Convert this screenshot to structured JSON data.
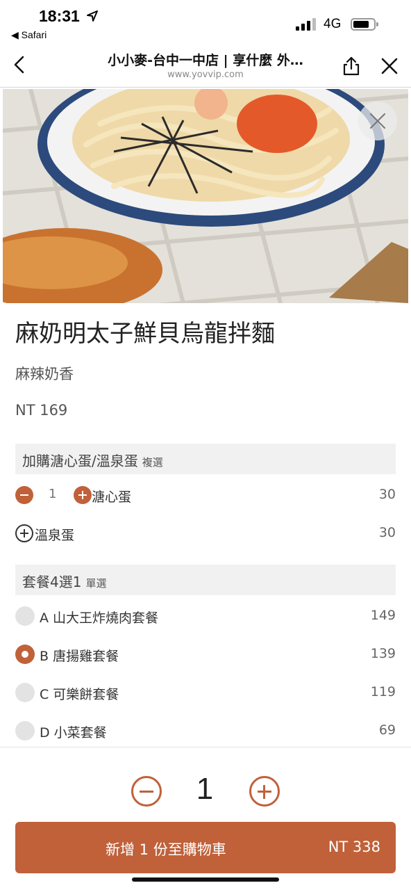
{
  "status_bar": {
    "time": "18:31",
    "back_app": "◀ Safari",
    "network": "4G"
  },
  "browser": {
    "title": "小小麥-台中一中店 | 享什麼 外…",
    "url": "www.yovvip.com"
  },
  "item": {
    "name": "麻奶明太子鮮貝烏龍拌麵",
    "description": "麻辣奶香",
    "price": "NT 169"
  },
  "addons": {
    "title": "加購溏心蛋/溫泉蛋",
    "subtitle": "複選",
    "options": [
      {
        "label": "溏心蛋",
        "price": "30",
        "qty": "1"
      },
      {
        "label": "溫泉蛋",
        "price": "30"
      }
    ]
  },
  "combo": {
    "title": "套餐4選1",
    "subtitle": "單選",
    "options": [
      {
        "label": "A 山大王炸燒肉套餐",
        "price": "149",
        "selected": false
      },
      {
        "label": "B 唐揚雞套餐",
        "price": "139",
        "selected": true
      },
      {
        "label": "C 可樂餅套餐",
        "price": "119",
        "selected": false
      },
      {
        "label": "D 小菜套餐",
        "price": "69",
        "selected": false
      }
    ]
  },
  "footer": {
    "quantity": "1",
    "button_label": "新增 1 份至購物車",
    "total": "NT 338"
  },
  "colors": {
    "accent": "#c0613a",
    "section_bg": "#f1f1f1"
  }
}
